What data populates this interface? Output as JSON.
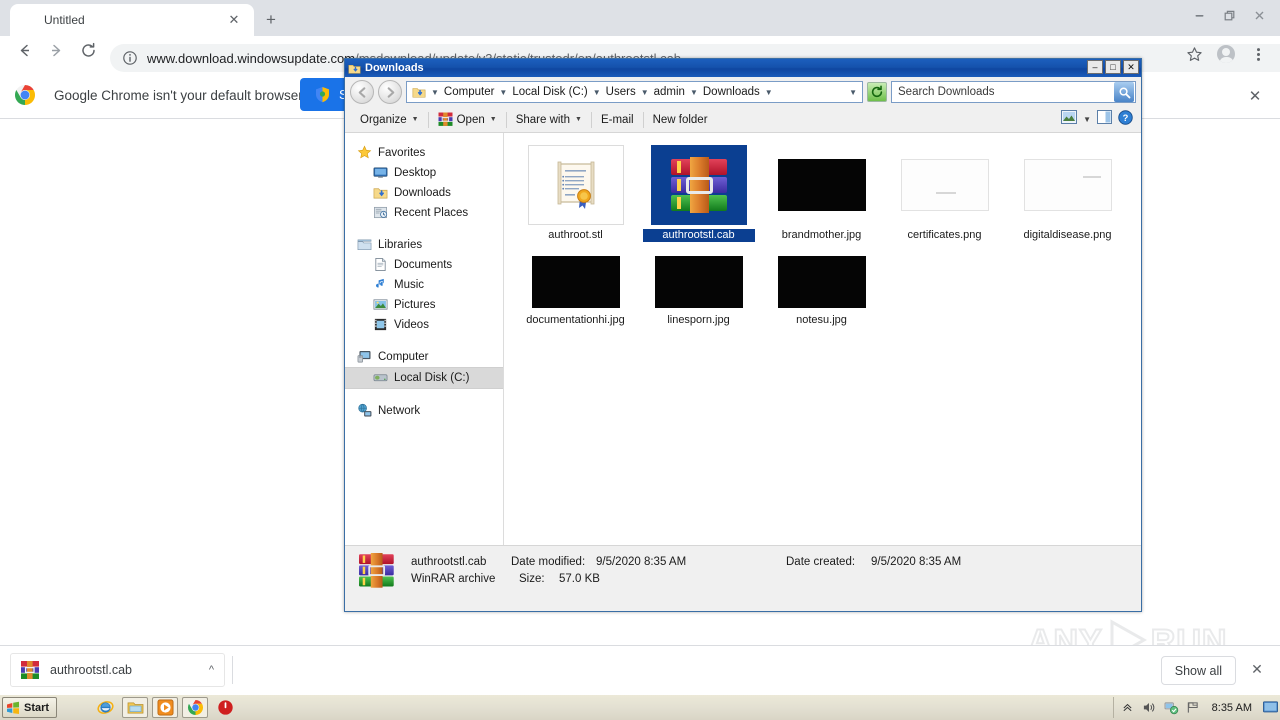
{
  "browser": {
    "tab_title": "Untitled",
    "tab_close_icon": "close-icon",
    "new_tab_icon": "plus-icon",
    "back_icon": "arrow-left-icon",
    "forward_icon": "arrow-right-icon",
    "reload_icon": "reload-icon",
    "site_info_icon": "info-circle-icon",
    "url_host": "www.download.windowsupdate.com",
    "url_path": "/msdownload/update/v3/static/trustedr/en/authrootstl.cab",
    "bookmark_icon": "star-icon",
    "profile_icon": "avatar-icon",
    "menu_icon": "three-dots-icon",
    "window_minimize_icon": "minimize-icon",
    "window_restore_icon": "restore-icon",
    "window_close_icon": "close-icon",
    "infobar": {
      "logo_icon": "chrome-logo-icon",
      "message": "Google Chrome isn't your default browser",
      "button_label": "Set as default",
      "button_icon": "shield-icon",
      "button_color": "#1a73e8",
      "close_icon": "close-icon"
    },
    "download_shelf": {
      "item_name": "authrootstl.cab",
      "item_icon": "winrar-file-icon",
      "item_caret_icon": "chevron-up-icon",
      "show_all_label": "Show all",
      "close_icon": "close-icon"
    }
  },
  "watermark": {
    "left": "ANY",
    "right": "RUN",
    "play_icon": "play-triangle-icon"
  },
  "explorer": {
    "title": "Downloads",
    "title_icon": "downloads-folder-icon",
    "window_buttons": {
      "minimize": "–",
      "maximize": "□",
      "close": "✕"
    },
    "back_icon": "back-arrow-icon",
    "forward_icon": "forward-arrow-icon",
    "breadcrumb_icon": "downloads-folder-icon",
    "breadcrumbs": [
      "Computer",
      "Local Disk (C:)",
      "Users",
      "admin",
      "Downloads"
    ],
    "breadcrumb_dropdown_icon": "chevron-down-icon",
    "refresh_icon": "refresh-icon",
    "search_placeholder": "Search Downloads",
    "search_icon": "search-icon",
    "toolbar": {
      "organize": "Organize",
      "open": "Open",
      "open_icon": "winrar-icon",
      "share_with": "Share with",
      "email": "E-mail",
      "new_folder": "New folder",
      "preview_icon": "preview-pane-icon",
      "view_dropdown_icon": "chevron-down-icon",
      "layout_icon": "show-pane-icon",
      "help_icon": "help-icon"
    },
    "nav_pane": {
      "favorites": {
        "label": "Favorites",
        "icon": "star-icon",
        "items": [
          {
            "label": "Desktop",
            "icon": "desktop-icon"
          },
          {
            "label": "Downloads",
            "icon": "downloads-folder-icon"
          },
          {
            "label": "Recent Places",
            "icon": "recent-places-icon"
          }
        ]
      },
      "libraries": {
        "label": "Libraries",
        "icon": "libraries-icon",
        "items": [
          {
            "label": "Documents",
            "icon": "documents-icon"
          },
          {
            "label": "Music",
            "icon": "music-note-icon"
          },
          {
            "label": "Pictures",
            "icon": "pictures-icon"
          },
          {
            "label": "Videos",
            "icon": "videos-icon"
          }
        ]
      },
      "computer": {
        "label": "Computer",
        "icon": "computer-icon",
        "items": [
          {
            "label": "Local Disk (C:)",
            "icon": "hard-disk-icon",
            "selected": true
          }
        ]
      },
      "network": {
        "label": "Network",
        "icon": "network-icon"
      }
    },
    "files": [
      {
        "name": "authroot.stl",
        "thumb": "certificate-icon",
        "selected": false
      },
      {
        "name": "authrootstl.cab",
        "thumb": "winrar-icon",
        "selected": true
      },
      {
        "name": "brandmother.jpg",
        "thumb": "black-image",
        "selected": false
      },
      {
        "name": "certificates.png",
        "thumb": "white-image",
        "selected": false
      },
      {
        "name": "digitaldisease.png",
        "thumb": "white-image",
        "selected": false
      },
      {
        "name": "documentationhi.jpg",
        "thumb": "black-image",
        "selected": false
      },
      {
        "name": "linesporn.jpg",
        "thumb": "black-image",
        "selected": false
      },
      {
        "name": "notesu.jpg",
        "thumb": "black-image",
        "selected": false
      }
    ],
    "details": {
      "icon": "winrar-file-icon",
      "file_name": "authrootstl.cab",
      "file_type": "WinRAR archive",
      "date_modified_label": "Date modified:",
      "date_modified_value": "9/5/2020 8:35 AM",
      "date_created_label": "Date created:",
      "date_created_value": "9/5/2020 8:35 AM",
      "size_label": "Size:",
      "size_value": "57.0 KB"
    }
  },
  "taskbar": {
    "start_label": "Start",
    "start_icon": "windows-flag-icon",
    "apps": [
      {
        "name": "internet-explorer",
        "icon": "ie-icon",
        "active": false
      },
      {
        "name": "windows-explorer",
        "icon": "explorer-icon",
        "active": true
      },
      {
        "name": "media-player",
        "icon": "media-player-icon",
        "active": true
      },
      {
        "name": "google-chrome",
        "icon": "chrome-icon",
        "active": true
      },
      {
        "name": "unknown-red-app",
        "icon": "red-circle-icon",
        "active": false
      }
    ],
    "tray": {
      "show_hidden_icon": "chevron-up-icon",
      "volume_icon": "speaker-icon",
      "network_icon": "network-tray-icon",
      "action_center_icon": "flag-icon",
      "clock": "8:35 AM",
      "show_desktop_icon": "show-desktop-icon"
    }
  }
}
